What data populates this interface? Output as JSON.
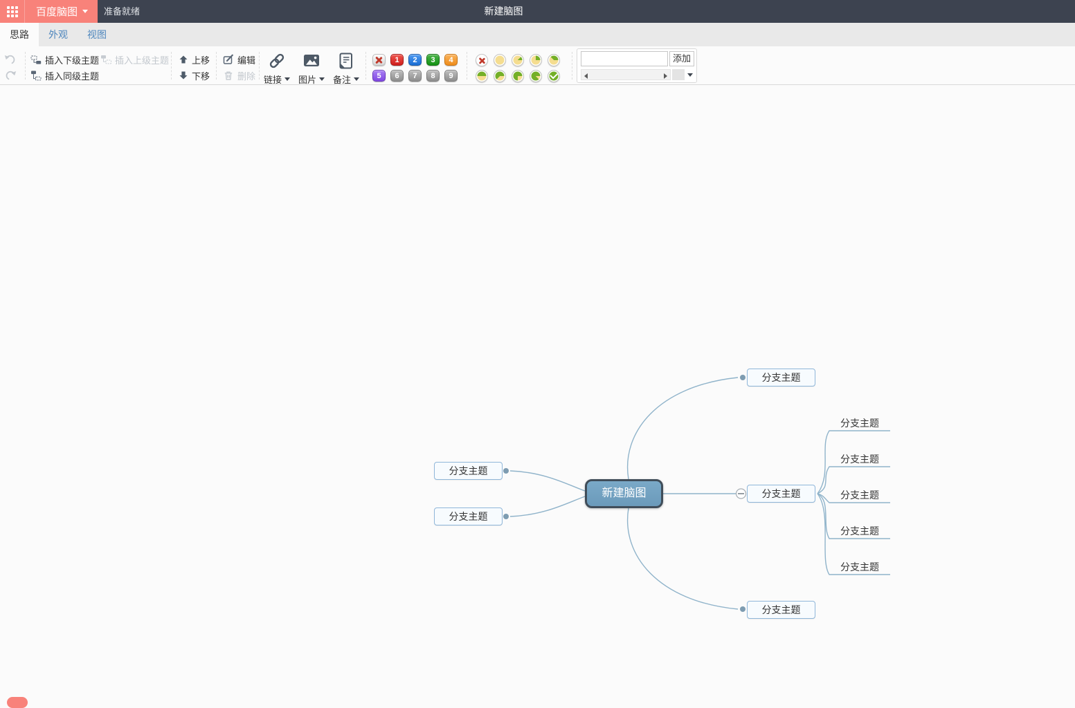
{
  "topbar": {
    "brand": "百度脑图",
    "status": "准备就绪",
    "title": "新建脑图"
  },
  "tabs": [
    {
      "label": "思路",
      "active": true
    },
    {
      "label": "外观",
      "active": false
    },
    {
      "label": "视图",
      "active": false
    }
  ],
  "toolbar": {
    "insert_child": "插入下级主题",
    "insert_parent": "插入上级主题",
    "insert_sibling": "插入同级主题",
    "move_up": "上移",
    "move_down": "下移",
    "edit": "编辑",
    "delete": "删除",
    "link": "链接",
    "image": "图片",
    "note": "备注",
    "add_button": "添加",
    "tag_input_value": "",
    "priorities": [
      "1",
      "2",
      "3",
      "4",
      "5",
      "6",
      "7",
      "8",
      "9"
    ]
  },
  "mindmap": {
    "root": "新建脑图",
    "left_branches": [
      "分支主题",
      "分支主题"
    ],
    "right_branches": [
      "分支主题",
      "分支主题",
      "分支主题"
    ],
    "sub_branches": [
      "分支主题",
      "分支主题",
      "分支主题",
      "分支主题",
      "分支主题"
    ]
  },
  "colors": {
    "accent_coral": "#f8827a",
    "topbar_navy": "#3d4350",
    "root_node_fill": "#73a2c2",
    "root_node_border": "#404d59",
    "branch_border": "#8fb6d9",
    "connector_line": "#8fb3ca",
    "priority_red": "#ce1f1d",
    "priority_blue": "#1c6ed2",
    "priority_green": "#149114",
    "priority_orange": "#ee8d1d",
    "priority_purple": "#8149e2",
    "progress_yellow": "#f5dd90",
    "progress_green": "#74af27"
  }
}
